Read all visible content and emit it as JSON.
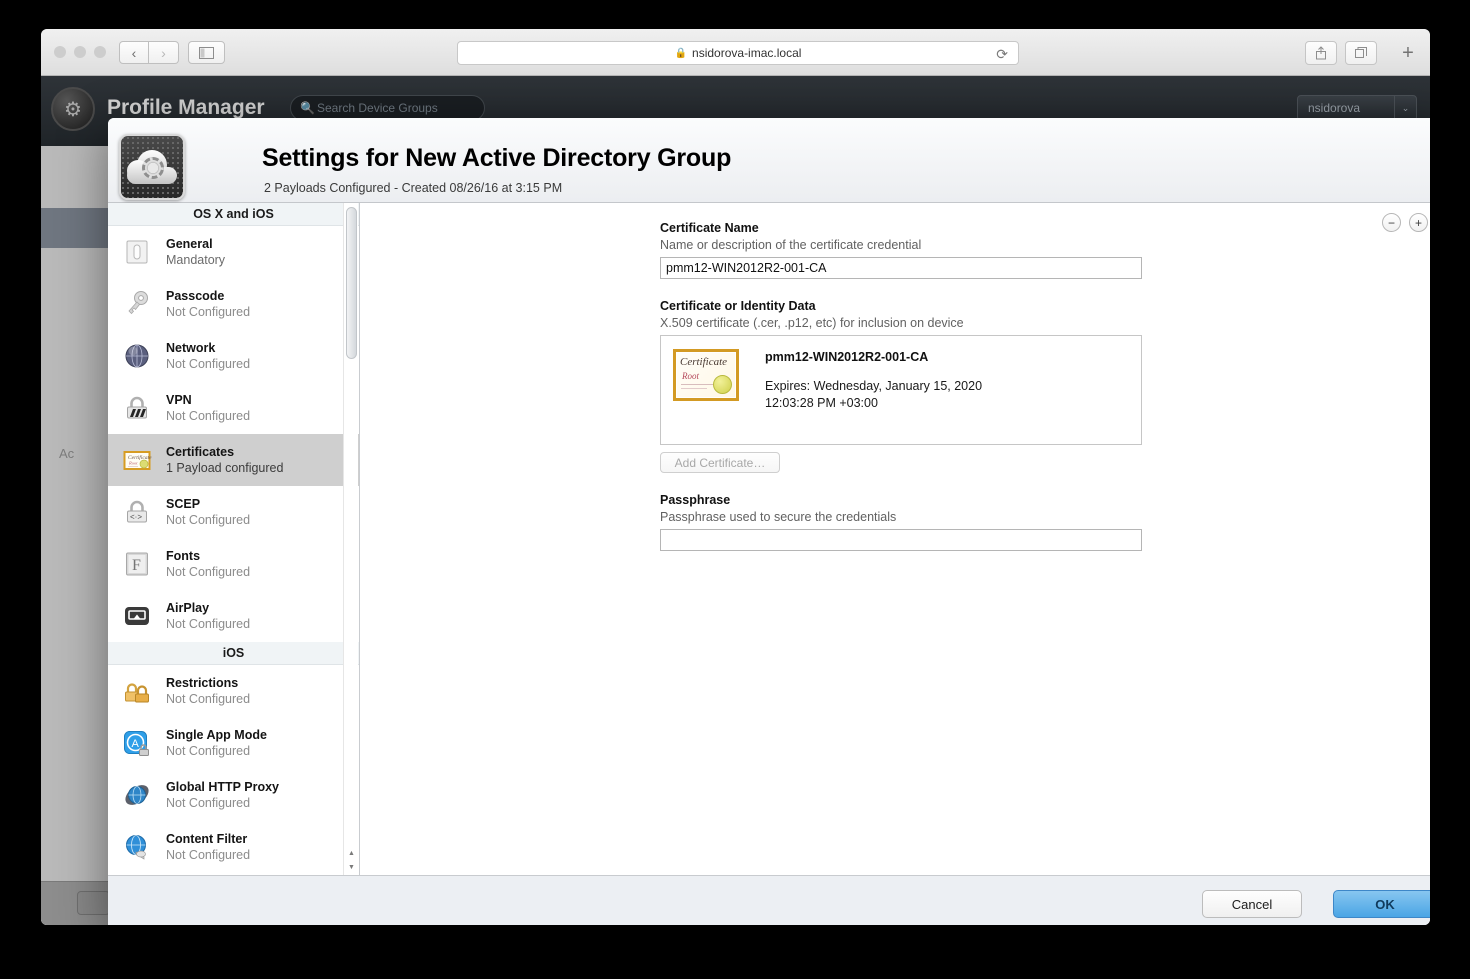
{
  "browser": {
    "url": "nsidorova-imac.local",
    "lock_icon": "lock-icon",
    "back_icon": "‹",
    "forward_icon": "›",
    "reload_icon": "⟳",
    "share_icon": "⇧",
    "tabs_icon": "⧉",
    "new_tab_icon": "+",
    "sidebar_icon": "▤"
  },
  "profile_manager": {
    "title": "Profile Manager",
    "search_placeholder": "Search Device Groups",
    "account_label": "nsidorova",
    "search_icon": "search-icon",
    "chevron_icon": "⌄",
    "background_label": "Ac"
  },
  "dialog": {
    "title": "Settings for New Active Directory Group",
    "subtitle": "2 Payloads Configured - Created 08/26/16 at 3:15 PM",
    "icon_name": "profile-settings-icon",
    "remove_payload_label": "−",
    "add_payload_label": "+",
    "cancel_label": "Cancel",
    "ok_label": "OK"
  },
  "sidebar": {
    "groups": [
      {
        "header": "OS X and iOS",
        "items": [
          {
            "label": "General",
            "status": "Mandatory",
            "icon": "general-icon",
            "selected": false
          },
          {
            "label": "Passcode",
            "status": "Not Configured",
            "icon": "key-icon",
            "selected": false
          },
          {
            "label": "Network",
            "status": "Not Configured",
            "icon": "network-globe-icon",
            "selected": false
          },
          {
            "label": "VPN",
            "status": "Not Configured",
            "icon": "vpn-lock-icon",
            "selected": false
          },
          {
            "label": "Certificates",
            "status": "1 Payload configured",
            "icon": "certificate-icon",
            "selected": true
          },
          {
            "label": "SCEP",
            "status": "Not Configured",
            "icon": "scep-lock-icon",
            "selected": false
          },
          {
            "label": "Fonts",
            "status": "Not Configured",
            "icon": "font-icon",
            "selected": false
          },
          {
            "label": "AirPlay",
            "status": "Not Configured",
            "icon": "airplay-icon",
            "selected": false
          }
        ]
      },
      {
        "header": "iOS",
        "items": [
          {
            "label": "Restrictions",
            "status": "Not Configured",
            "icon": "restrictions-locks-icon",
            "selected": false
          },
          {
            "label": "Single App Mode",
            "status": "Not Configured",
            "icon": "single-app-mode-icon",
            "selected": false
          },
          {
            "label": "Global HTTP Proxy",
            "status": "Not Configured",
            "icon": "global-http-proxy-icon",
            "selected": false
          },
          {
            "label": "Content Filter",
            "status": "Not Configured",
            "icon": "content-filter-icon",
            "selected": false
          }
        ]
      }
    ]
  },
  "form": {
    "certificate_name": {
      "label": "Certificate Name",
      "help": "Name or description of the certificate credential",
      "value": "pmm12-WIN2012R2-001-CA",
      "placeholder": ""
    },
    "certificate_data": {
      "label": "Certificate or Identity Data",
      "help": "X.509 certificate (.cer, .p12, etc) for inclusion on device",
      "cert_title": "pmm12-WIN2012R2-001-CA",
      "cert_expires": "Expires: Wednesday, January 15, 2020",
      "cert_expires_time": "12:03:28 PM +03:00",
      "thumb_title": "Certificate",
      "thumb_sub": "Root",
      "add_button": "Add Certificate…"
    },
    "passphrase": {
      "label": "Passphrase",
      "help": "Passphrase used to secure the credentials",
      "value": "",
      "placeholder": ""
    }
  },
  "colors": {
    "accent_blue": "#4aa5e5",
    "selected_row": "#cfcfcf",
    "group_header_bg": "#f0f4f6",
    "dialog_chrome": "#eceff3"
  }
}
